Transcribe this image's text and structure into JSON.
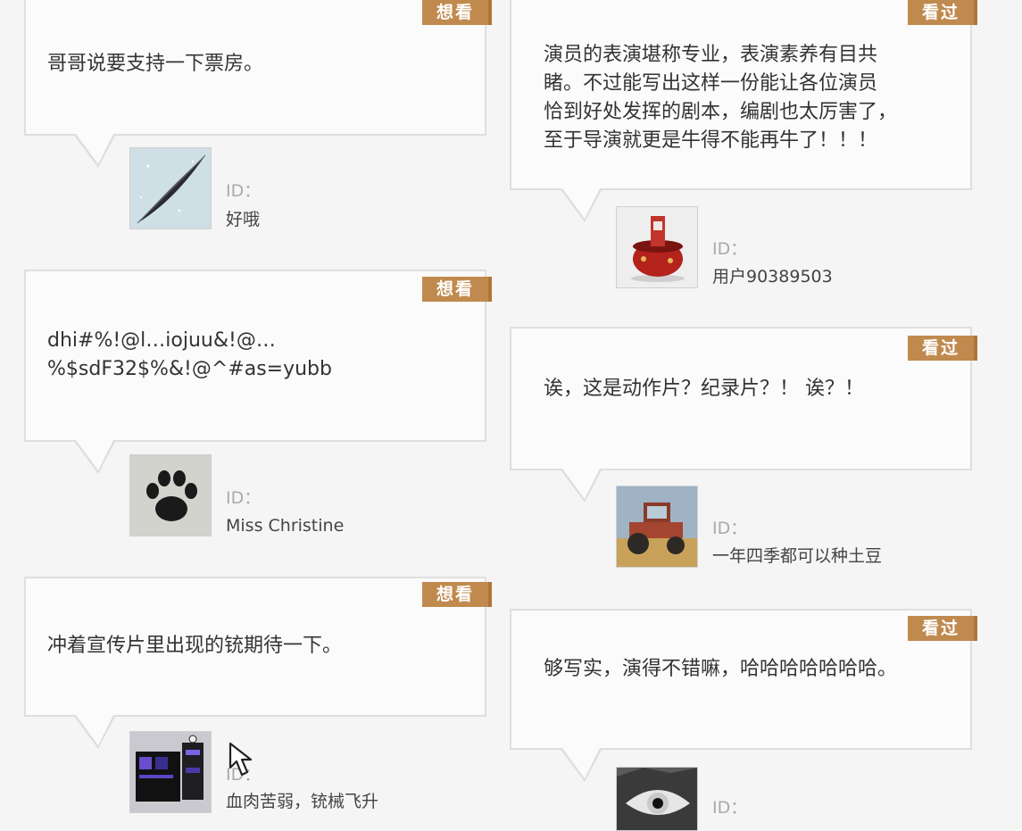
{
  "left_comments": [
    {
      "badge": "想看",
      "text": "哥哥说要支持一下票房。",
      "id_label": "ID：",
      "user": "好哦",
      "avatar": "feather-avatar"
    },
    {
      "badge": "想看",
      "text": "dhi#%!@l…iojuu&!@…\n%$sdF32$%&!@^#as=yubb",
      "id_label": "ID：",
      "user": "Miss Christine",
      "avatar": "paw-print-avatar"
    },
    {
      "badge": "想看",
      "text": "冲着宣传片里出现的铳期待一下。",
      "id_label": "ID：",
      "user": "血肉苦弱，铳械飞升",
      "avatar": "machine-avatar"
    }
  ],
  "right_comments": [
    {
      "badge": "看过",
      "text": "演员的表演堪称专业，表演素养有目共\n睹。不过能写出这样一份能让各位演员\n恰到好处发挥的剧本，编剧也太厉害了，\n至于导演就更是牛得不能再牛了！！！",
      "id_label": "ID：",
      "user": "用户90389503",
      "avatar": "hotpot-avatar"
    },
    {
      "badge": "看过",
      "text": "诶，这是动作片？纪录片？！ 诶？！",
      "id_label": "ID：",
      "user": "一年四季都可以种土豆",
      "avatar": "tractor-avatar"
    },
    {
      "badge": "看过",
      "text": "够写实，演得不错嘛，哈哈哈哈哈哈哈。",
      "id_label": "ID：",
      "user": "",
      "avatar": "wolf-eye-avatar"
    }
  ],
  "colors": {
    "badge": "#c08a4e",
    "badge_edge": "#b07438",
    "card_border": "#dedede",
    "background": "#f5f5f5"
  }
}
